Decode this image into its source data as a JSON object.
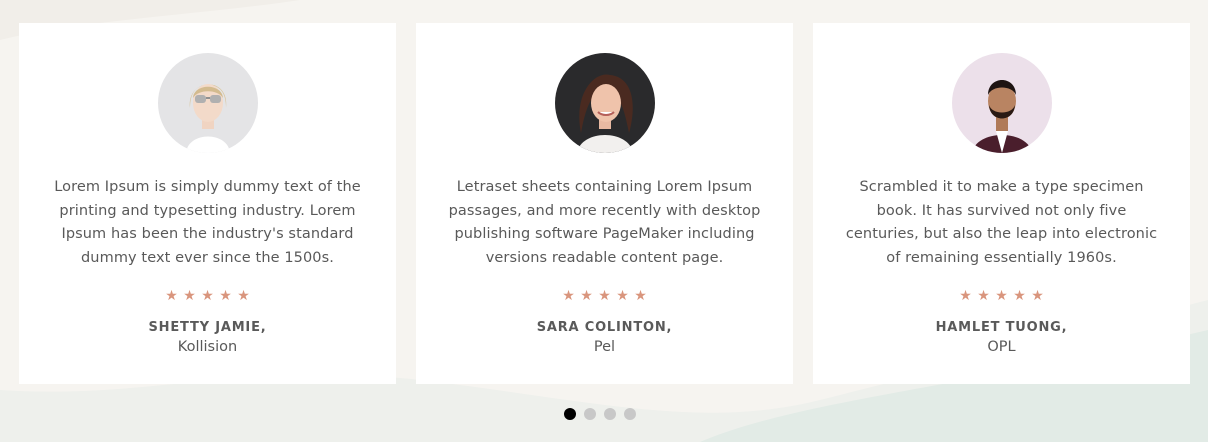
{
  "testimonials": [
    {
      "quote": "Lorem Ipsum is simply dummy text of the printing and typesetting industry. Lorem Ipsum has been the industry's standard dummy text ever since the 1500s.",
      "name": "SHETTY JAMIE,",
      "company": "Kollision",
      "rating": 5,
      "stars": "★★★★★"
    },
    {
      "quote": "Letraset sheets containing Lorem Ipsum passages, and more recently with desktop publishing software PageMaker including versions readable content page.",
      "name": "SARA COLINTON,",
      "company": "Pel",
      "rating": 5,
      "stars": "★★★★★"
    },
    {
      "quote": "Scrambled it to make a type specimen book. It has survived not only five centuries, but also the leap into electronic of remaining essentially 1960s.",
      "name": "HAMLET TUONG,",
      "company": "OPL",
      "rating": 5,
      "stars": "★★★★★"
    }
  ],
  "pagination": {
    "total": 4,
    "active": 1
  },
  "colors": {
    "star": "#d9957d",
    "background": "#f6f4f0",
    "card": "#ffffff",
    "dot_active": "#000000",
    "dot_inactive": "#c8c8c8"
  }
}
